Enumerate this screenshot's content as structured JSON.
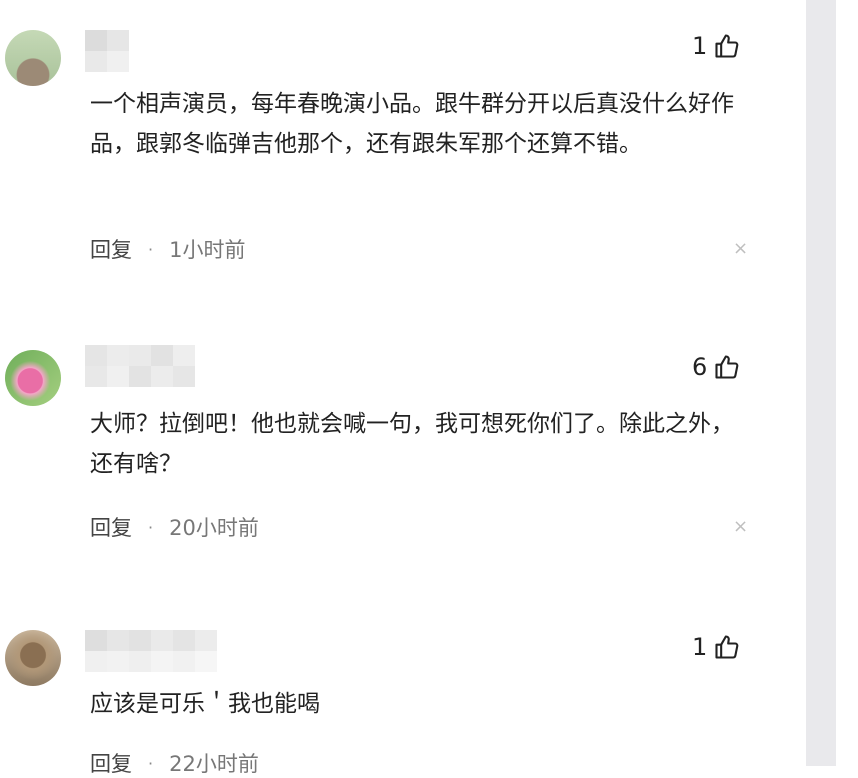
{
  "comments": [
    {
      "likes": "1",
      "text": "一个相声演员，每年春晚演小品。跟牛群分开以后真没什么好作品，跟郭冬临弹吉他那个，还有跟朱军那个还算不错。",
      "reply_label": "回复",
      "separator": "·",
      "time": "1小时前",
      "close_glyph": "×"
    },
    {
      "likes": "6",
      "text": "大师？拉倒吧！他也就会喊一句，我可想死你们了。除此之外，还有啥？",
      "reply_label": "回复",
      "separator": "·",
      "time": "20小时前",
      "close_glyph": "×"
    },
    {
      "likes": "1",
      "text": "应该是可乐＇我也能喝",
      "reply_label": "回复",
      "separator": "·",
      "time": "22小时前",
      "close_glyph": "×"
    }
  ],
  "colors": {
    "background": "#ffffff",
    "scrollbar_track": "#e9e9ec",
    "text": "#222222",
    "muted": "#777777"
  },
  "icons": {
    "like": "thumbs-up-icon",
    "close": "close-icon",
    "avatar": "avatar"
  }
}
